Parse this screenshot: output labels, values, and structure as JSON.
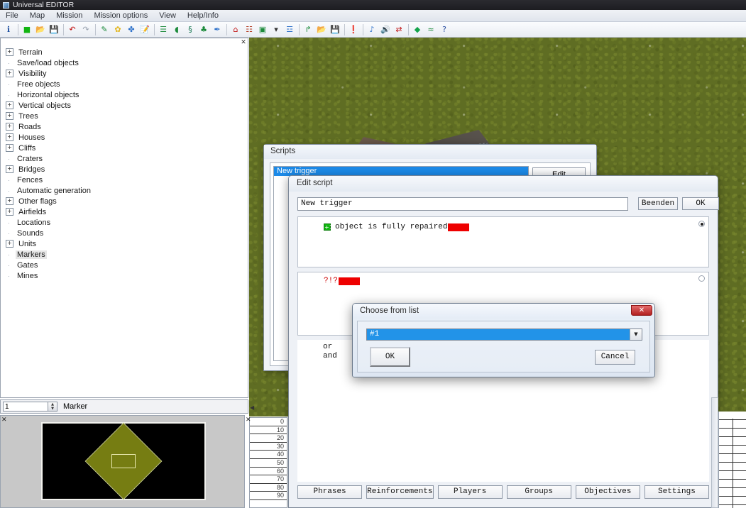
{
  "app": {
    "title": "Universal EDITOR",
    "window_icon": "app-icon"
  },
  "menubar": {
    "items": [
      "File",
      "Map",
      "Mission",
      "Mission options",
      "View",
      "Help/Info"
    ]
  },
  "toolbar": {
    "buttons": [
      {
        "name": "info-icon",
        "glyph": "ℹ"
      },
      {
        "sep": true
      },
      {
        "name": "new-file-icon",
        "glyph": "■"
      },
      {
        "name": "open-folder-icon",
        "glyph": "📂"
      },
      {
        "name": "save-icon",
        "glyph": "💾"
      },
      {
        "sep": true
      },
      {
        "name": "undo-icon",
        "glyph": "↶"
      },
      {
        "name": "redo-icon",
        "glyph": "↷"
      },
      {
        "sep": true
      },
      {
        "name": "terrain-brush-icon",
        "glyph": "✎"
      },
      {
        "name": "flower-icon",
        "glyph": "✿"
      },
      {
        "name": "add-object-icon",
        "glyph": "✤"
      },
      {
        "name": "edit-note-icon",
        "glyph": "📝"
      },
      {
        "sep": true
      },
      {
        "name": "list-objects-icon",
        "glyph": "☰"
      },
      {
        "name": "leaf-icon",
        "glyph": "◖"
      },
      {
        "name": "script-icon",
        "glyph": "§"
      },
      {
        "name": "tree-icon",
        "glyph": "♣"
      },
      {
        "name": "pencil-icon",
        "glyph": "✒"
      },
      {
        "sep": true
      },
      {
        "name": "house-icon",
        "glyph": "⌂"
      },
      {
        "name": "fence-icon",
        "glyph": "☷"
      },
      {
        "name": "building-icon",
        "glyph": "▣"
      },
      {
        "name": "dropdown-arrow-icon",
        "glyph": "▾"
      },
      {
        "name": "bridge-icon",
        "glyph": "☲"
      },
      {
        "sep": true
      },
      {
        "name": "import-icon",
        "glyph": "↱"
      },
      {
        "name": "open-mission-icon",
        "glyph": "📂"
      },
      {
        "name": "save-mission-icon",
        "glyph": "💾"
      },
      {
        "sep": true
      },
      {
        "name": "alert-icon",
        "glyph": "❗"
      },
      {
        "sep": true
      },
      {
        "name": "sound-place-icon",
        "glyph": "♪"
      },
      {
        "name": "speaker-icon",
        "glyph": "🔊"
      },
      {
        "name": "swap-icon",
        "glyph": "⇄"
      },
      {
        "sep": true
      },
      {
        "name": "marker-diamond-icon",
        "glyph": "◆"
      },
      {
        "name": "wave-icon",
        "glyph": "≈"
      },
      {
        "name": "help-icon",
        "glyph": "?"
      }
    ]
  },
  "left_panel": {
    "close_glyph": "✕",
    "tree": [
      {
        "label": "Terrain",
        "expandable": true,
        "selected": false
      },
      {
        "label": "Save/load objects",
        "expandable": false,
        "selected": false
      },
      {
        "label": "Visibility",
        "expandable": true,
        "selected": false
      },
      {
        "label": "Free objects",
        "expandable": false,
        "selected": false
      },
      {
        "label": "Horizontal objects",
        "expandable": false,
        "selected": false
      },
      {
        "label": "Vertical objects",
        "expandable": true,
        "selected": false
      },
      {
        "label": "Trees",
        "expandable": true,
        "selected": false
      },
      {
        "label": "Roads",
        "expandable": true,
        "selected": false
      },
      {
        "label": "Houses",
        "expandable": true,
        "selected": false
      },
      {
        "label": "Cliffs",
        "expandable": true,
        "selected": false
      },
      {
        "label": "Craters",
        "expandable": false,
        "selected": false
      },
      {
        "label": "Bridges",
        "expandable": true,
        "selected": false
      },
      {
        "label": "Fences",
        "expandable": false,
        "selected": false
      },
      {
        "label": "Automatic generation",
        "expandable": false,
        "selected": false
      },
      {
        "label": "Other flags",
        "expandable": true,
        "selected": false
      },
      {
        "label": "Airfields",
        "expandable": true,
        "selected": false
      },
      {
        "label": "Locations",
        "expandable": false,
        "selected": false
      },
      {
        "label": "Sounds",
        "expandable": false,
        "selected": false
      },
      {
        "label": "Units",
        "expandable": true,
        "selected": false
      },
      {
        "label": "Markers",
        "expandable": false,
        "selected": true
      },
      {
        "label": "Gates",
        "expandable": false,
        "selected": false
      },
      {
        "label": "Mines",
        "expandable": false,
        "selected": false
      }
    ],
    "expand_glyph": "+",
    "leaf_glyph": "·"
  },
  "marker_row": {
    "value": "1",
    "label": "Marker",
    "up_glyph": "▲",
    "down_glyph": "▼"
  },
  "minimap": {
    "close_glyph": "✕"
  },
  "num_strip": {
    "close_glyph": "✕",
    "collapse_glyph": "◀",
    "values": [
      "0",
      "10",
      "20",
      "30",
      "40",
      "50",
      "60",
      "70",
      "80",
      "90"
    ]
  },
  "scripts_window": {
    "title": "Scripts",
    "selected_trigger": "New trigger",
    "edit_button": "Edit"
  },
  "edit_script_window": {
    "title": "Edit script",
    "name_value": "New trigger",
    "beenden_button": "Beenden",
    "ok_button": "OK",
    "condition": {
      "plus_glyph": "+1",
      "text": "object is fully repaired",
      "redacted": true
    },
    "action": {
      "text": "?!?",
      "redacted": true
    },
    "logic": [
      "or",
      "and"
    ],
    "bottom_buttons": [
      "Phrases",
      "Reinforcements",
      "Players",
      "Groups",
      "Objectives",
      "Settings"
    ]
  },
  "choose_dialog": {
    "title": "Choose from list",
    "close_glyph": "✕",
    "selected_value": "#1",
    "arrow_glyph": "▼",
    "ok_button": "OK",
    "cancel_button": "Cancel"
  },
  "colors": {
    "accent_blue": "#1c8ae8",
    "redaction_red": "#ee0000",
    "grass_green": "#5f6d23",
    "minimap_olive": "#767d12",
    "titlebar_dark": "#1d1d21"
  }
}
